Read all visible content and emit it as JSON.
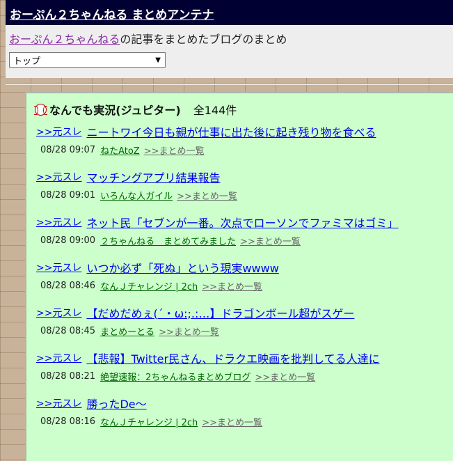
{
  "header": {
    "site_title": "おーぷん２ちゃんねる まとめアンテナ"
  },
  "subheader": {
    "desc_link": "おーぷん２ちゃんねる",
    "desc_suffix": "の記事をまとめたブログのまとめ",
    "select_value": "トップ"
  },
  "panel": {
    "category": "なんでも実況(ジュピター)",
    "count": "全144件",
    "articles": [
      {
        "src": ">>元スレ",
        "title": "ニートワイ今日も親が仕事に出た後に起き残り物を食べる",
        "time": "08/28 09:07",
        "blog": "ねたAtoZ",
        "summary": ">>まとめ一覧"
      },
      {
        "src": ">>元スレ",
        "title": "マッチングアプリ結果報告",
        "time": "08/28 09:01",
        "blog": "いろんな人ガイル",
        "summary": ">>まとめ一覧"
      },
      {
        "src": ">>元スレ",
        "title": "ネット民「セブンが一番。次点でローソンでファミマはゴミ」",
        "time": "08/28 09:00",
        "blog": "２ちゃんねる　まとめてみました",
        "summary": ">>まとめ一覧"
      },
      {
        "src": ">>元スレ",
        "title": "いつか必ず「死ぬ」という現実wwww",
        "time": "08/28 08:46",
        "blog": "なんＪチャレンジ | 2ch",
        "summary": ">>まとめ一覧"
      },
      {
        "src": ">>元スレ",
        "title": "【だめだめぇ(´・ω:;.:…】ドラゴンボール超がスゲー",
        "time": "08/28 08:45",
        "blog": "まとめーとる",
        "summary": ">>まとめ一覧"
      },
      {
        "src": ">>元スレ",
        "title": "【悲報】Twitter民さん、ドラクエ映画を批判してる人達に",
        "time": "08/28 08:21",
        "blog": "絶望速報：2ちゃんねるまとめブログ",
        "summary": ">>まとめ一覧"
      },
      {
        "src": ">>元スレ",
        "title": "勝ったDe〜",
        "time": "08/28 08:16",
        "blog": "なんＪチャレンジ | 2ch",
        "summary": ">>まとめ一覧"
      }
    ]
  }
}
